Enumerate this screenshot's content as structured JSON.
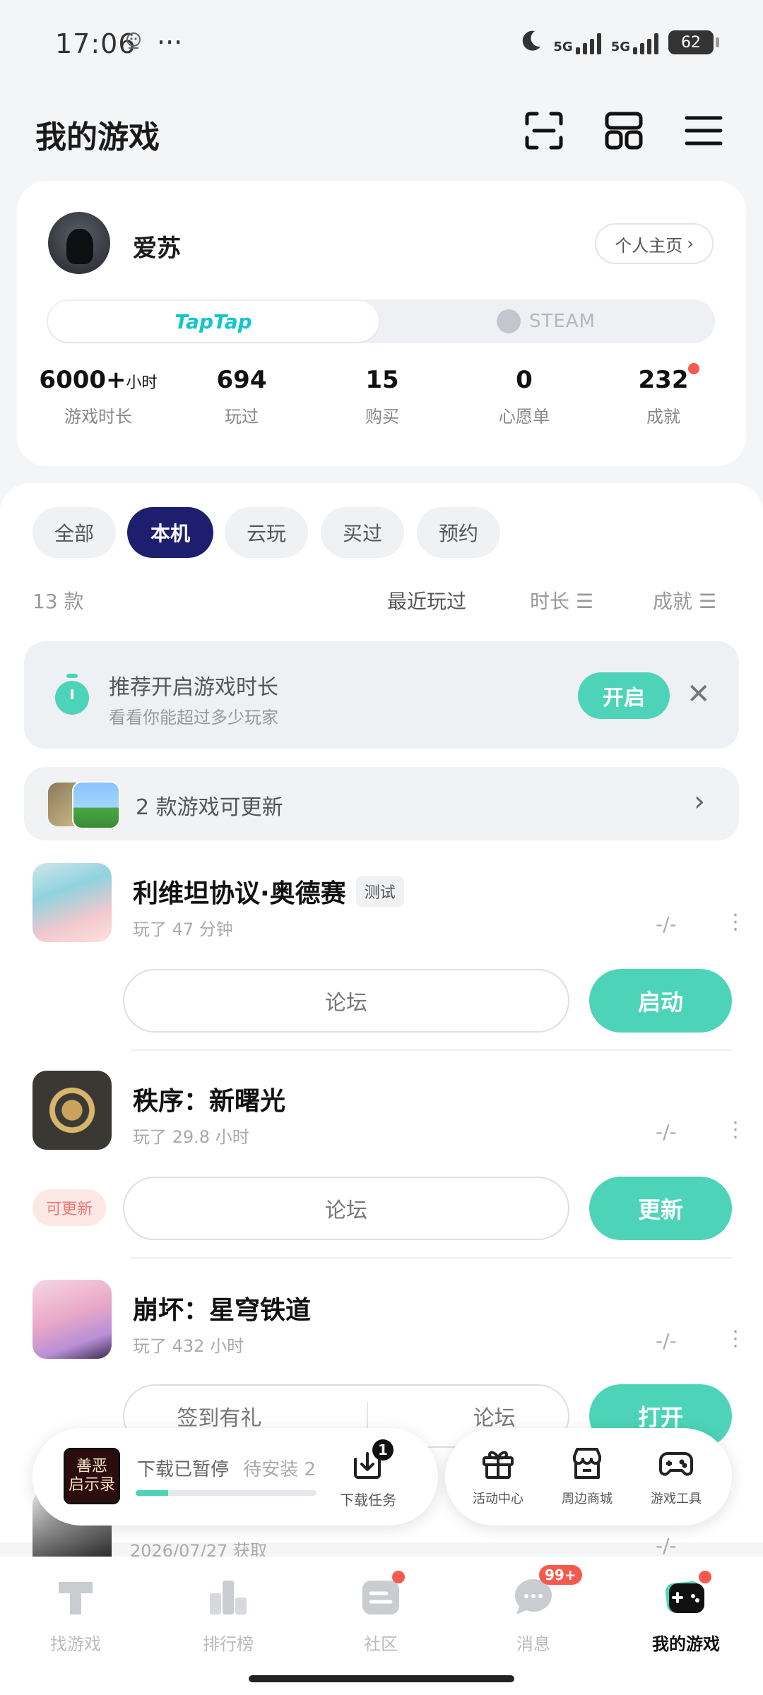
{
  "status_bar": {
    "time": "17:06",
    "dots": "···",
    "net1": "5G",
    "net2": "5G",
    "battery": "62"
  },
  "header": {
    "title": "我的游戏",
    "scan_icon": "scan-icon",
    "grid_icon": "grid-icon",
    "menu_icon": "menu-icon"
  },
  "profile": {
    "username": "爱苏",
    "home_button": "个人主页",
    "platforms": {
      "taptap": "TapTap",
      "steam": "STEAM"
    },
    "stats": [
      {
        "value": "6000+",
        "unit": "小时",
        "label": "游戏时长"
      },
      {
        "value": "694",
        "unit": "",
        "label": "玩过"
      },
      {
        "value": "15",
        "unit": "",
        "label": "购买"
      },
      {
        "value": "0",
        "unit": "",
        "label": "心愿单"
      },
      {
        "value": "232",
        "unit": "",
        "label": "成就"
      }
    ]
  },
  "filters": [
    "全部",
    "本机",
    "云玩",
    "买过",
    "预约"
  ],
  "active_filter": "本机",
  "list_header": {
    "count": "13 款",
    "sort_recent": "最近玩过",
    "sort_duration": "时长 ☰",
    "sort_achievement": "成就 ☰"
  },
  "recommend": {
    "title": "推荐开启游戏时长",
    "subtitle": "看看你能超过多少玩家",
    "button": "开启"
  },
  "update_row": {
    "text": "2 款游戏可更新"
  },
  "games": [
    {
      "name": "利维坦协议·奥德赛",
      "tag": "测试",
      "meta": "玩了 47 分钟",
      "score": "-/-",
      "forum": "论坛",
      "action": "启动"
    },
    {
      "name": "秩序：新曙光",
      "meta": "玩了 29.8 小时",
      "score": "-/-",
      "update_tag": "可更新",
      "forum": "论坛",
      "action": "更新"
    },
    {
      "name": "崩坏：星穹铁道",
      "meta": "玩了 432 小时",
      "score": "-/-",
      "extra": "签到有礼",
      "forum": "论坛",
      "action": "打开"
    },
    {
      "name": "",
      "meta": "2026/07/27 获取",
      "score": "-/-"
    }
  ],
  "download": {
    "thumb_line1": "善恶",
    "thumb_line2": "启示录",
    "status": "下载已暂停",
    "pending": "待安装 2",
    "progress": 0.18,
    "task_label": "下载任务",
    "task_badge": "1"
  },
  "tools": [
    {
      "label": "活动中心",
      "icon": "gift-icon"
    },
    {
      "label": "周边商城",
      "icon": "shop-icon"
    },
    {
      "label": "游戏工具",
      "icon": "gamepad-icon"
    }
  ],
  "bottom_nav": [
    {
      "label": "找游戏",
      "icon": "taptap-icon"
    },
    {
      "label": "排行榜",
      "icon": "ranking-icon"
    },
    {
      "label": "社区",
      "icon": "community-icon"
    },
    {
      "label": "消息",
      "icon": "message-icon",
      "badge": "99+"
    },
    {
      "label": "我的游戏",
      "icon": "mygames-icon"
    }
  ],
  "colors": {
    "accent": "#4dd4b8",
    "brand": "#15c5ce",
    "active_chip": "#1d1f6e",
    "badge": "#f55a4e"
  }
}
